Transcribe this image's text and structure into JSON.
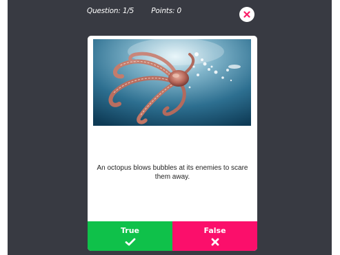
{
  "hud": {
    "question_label": "Question: 1/5",
    "points_label": "Points: 0"
  },
  "icons": {
    "close": "close-icon",
    "true": "checkmark-icon",
    "false": "x-mark-icon"
  },
  "quiz": {
    "statement": "An octopus blows bubbles at its enemies to scare them away.",
    "true_label": "True",
    "false_label": "False"
  },
  "colors": {
    "background": "#383a42",
    "true": "#0fc14a",
    "false": "#fb0f6b",
    "close_x": "#fb1d67"
  }
}
